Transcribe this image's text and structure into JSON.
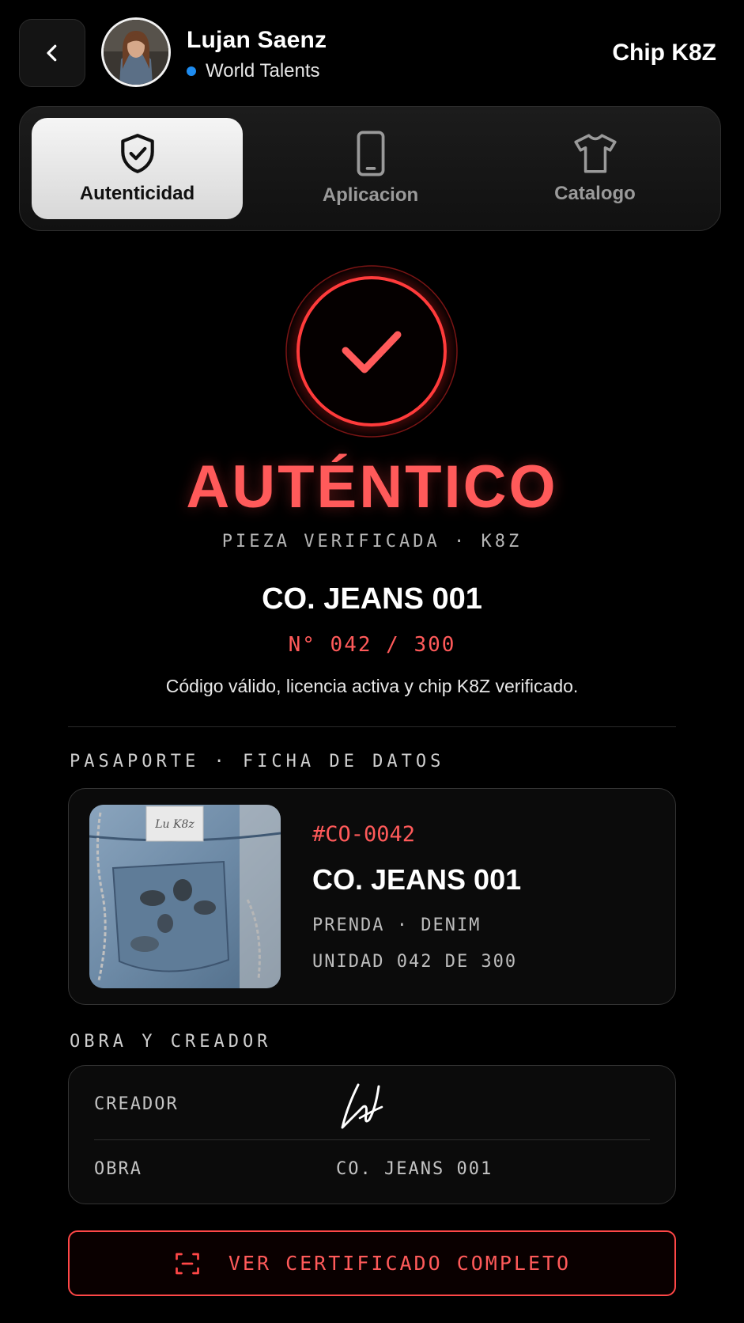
{
  "header": {
    "user_name": "Lujan Saenz",
    "organization": "World Talents",
    "org_status_color": "#1e8cf0",
    "chip_label": "Chip K8Z"
  },
  "tabs": [
    {
      "label": "Autenticidad",
      "icon": "shield-check-icon",
      "active": true
    },
    {
      "label": "Aplicacion",
      "icon": "smartphone-icon",
      "active": false
    },
    {
      "label": "Catalogo",
      "icon": "tshirt-icon",
      "active": false
    }
  ],
  "verification": {
    "status": "AUTÉNTICO",
    "subtitle": "PIEZA VERIFICADA · K8Z",
    "product_name": "CO. JEANS 001",
    "edition": "N° 042 / 300",
    "description": "Código válido, licencia activa y chip K8Z verificado.",
    "accent_color": "#ff5a5a"
  },
  "passport": {
    "section_title": "PASAPORTE · FICHA DE DATOS",
    "code": "#CO-0042",
    "name": "CO. JEANS 001",
    "type": "PRENDA · DENIM",
    "unit": "UNIDAD 042 DE 300",
    "tag_text": "Lu K8z"
  },
  "creator_section": {
    "section_title": "OBRA Y CREADOR",
    "creator_label": "CREADOR",
    "work_label": "OBRA",
    "work_value": "CO. JEANS 001"
  },
  "cta": {
    "label": "VER CERTIFICADO COMPLETO",
    "icon": "scan-frame-icon"
  }
}
